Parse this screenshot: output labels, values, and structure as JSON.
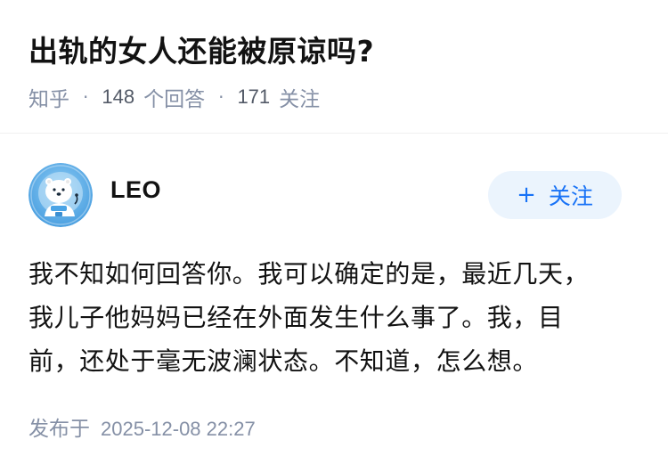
{
  "question": {
    "title": "出轨的女人还能被原谅吗?",
    "source": "知乎",
    "answer_count": "148",
    "answer_label": "个回答",
    "follow_count": "171",
    "follow_label": "关注",
    "separator": "·"
  },
  "author": {
    "name": "LEO",
    "avatar_icon": "polar-bear-astronaut-avatar",
    "follow_plus": "+",
    "follow_label": "关注"
  },
  "answer": {
    "lines": [
      "我不知如何回答你。我可以确定的是，最近几天，",
      "我儿子他妈妈已经在外面发生什么事了。我，目",
      "前，还处于毫无波澜状态。不知道，怎么想。"
    ],
    "published_label": "发布于",
    "published_time": "2025-12-08 22:27"
  },
  "colors": {
    "title": "#121212",
    "meta": "#8590a6",
    "accent": "#1772f6",
    "follow_bg": "#ebf4fd",
    "avatar_bg": "#5aaee8"
  }
}
